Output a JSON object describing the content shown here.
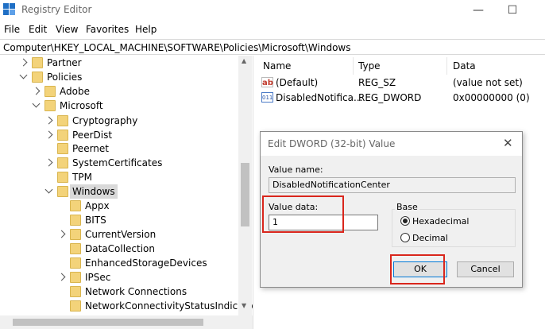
{
  "window": {
    "title": "Registry Editor",
    "minimize": "—",
    "maximize": "☐"
  },
  "menu": [
    "File",
    "Edit",
    "View",
    "Favorites",
    "Help"
  ],
  "address": "Computer\\HKEY_LOCAL_MACHINE\\SOFTWARE\\Policies\\Microsoft\\Windows",
  "tree": {
    "partner": "Partner",
    "policies": "Policies",
    "adobe": "Adobe",
    "microsoft": "Microsoft",
    "cryptography": "Cryptography",
    "peerdist": "PeerDist",
    "peernet": "Peernet",
    "systemcertificates": "SystemCertificates",
    "tpm": "TPM",
    "windows": "Windows",
    "appx": "Appx",
    "bits": "BITS",
    "currentversion": "CurrentVersion",
    "datacollection": "DataCollection",
    "enhancedstorage": "EnhancedStorageDevices",
    "ipsec": "IPSec",
    "networkconnections": "Network Connections",
    "ncsi": "NetworkConnectivityStatusIndicator"
  },
  "list": {
    "headers": {
      "name": "Name",
      "type": "Type",
      "data": "Data"
    },
    "rows": [
      {
        "name": "(Default)",
        "type": "REG_SZ",
        "data": "(value not set)",
        "icon": "string-value-icon"
      },
      {
        "name": "DisabledNotifica...",
        "type": "REG_DWORD",
        "data": "0x00000000 (0)",
        "icon": "binary-value-icon"
      }
    ]
  },
  "dialog": {
    "title": "Edit DWORD (32-bit) Value",
    "close": "✕",
    "value_name_label": "Value name:",
    "value_name": "DisabledNotificationCenter",
    "value_data_label": "Value data:",
    "value_data": "1",
    "base_label": "Base",
    "hex_label": "Hexadecimal",
    "dec_label": "Decimal",
    "ok_label": "OK",
    "cancel_label": "Cancel",
    "selected_base": "Hexadecimal"
  },
  "colors": {
    "highlight": "#d9261c",
    "folder": "#f3d37a",
    "accent": "#0078d7"
  }
}
